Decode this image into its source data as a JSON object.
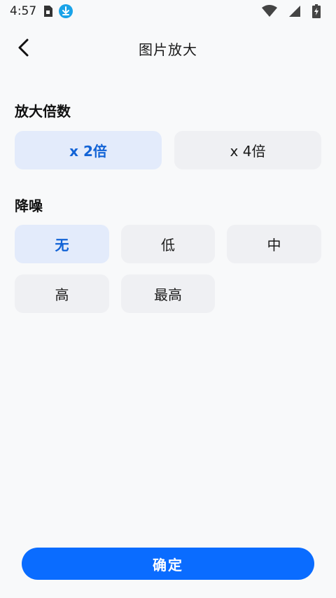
{
  "status_bar": {
    "time": "4:57",
    "icons": [
      "sim-card-icon",
      "download-icon",
      "wifi-icon",
      "signal-icon",
      "battery-charging-icon"
    ]
  },
  "header": {
    "title": "图片放大"
  },
  "scale_section": {
    "title": "放大倍数",
    "options": [
      {
        "label": "x 2倍",
        "selected": true
      },
      {
        "label": "x 4倍",
        "selected": false
      }
    ]
  },
  "denoise_section": {
    "title": "降噪",
    "options": [
      {
        "label": "无",
        "selected": true
      },
      {
        "label": "低",
        "selected": false
      },
      {
        "label": "中",
        "selected": false
      },
      {
        "label": "高",
        "selected": false
      },
      {
        "label": "最高",
        "selected": false
      }
    ]
  },
  "confirm_button": {
    "label": "确定"
  },
  "colors": {
    "accent": "#0a6cff",
    "selected_bg": "#e3ebfb",
    "selected_text": "#1263d6",
    "option_bg": "#eff0f3",
    "download_badge": "#1aa3e8"
  }
}
